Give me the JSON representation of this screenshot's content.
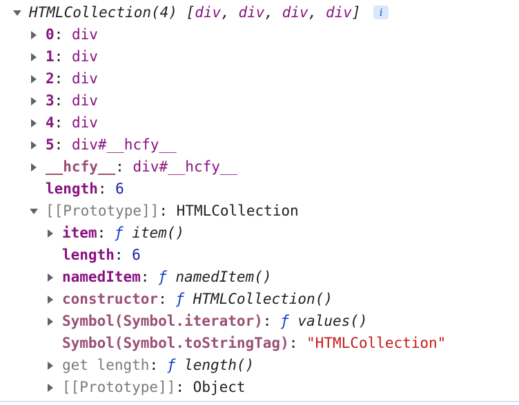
{
  "header": {
    "label": "HTMLCollection(4)",
    "preview_open": "[",
    "preview_items": [
      "div",
      "div",
      "div",
      "div"
    ],
    "preview_sep": ", ",
    "preview_close": "]",
    "info_icon": "i"
  },
  "items": [
    {
      "key": "0",
      "value": "div"
    },
    {
      "key": "1",
      "value": "div"
    },
    {
      "key": "2",
      "value": "div"
    },
    {
      "key": "3",
      "value": "div"
    },
    {
      "key": "4",
      "value": "div"
    },
    {
      "key": "5",
      "value": "div#__hcfy__"
    }
  ],
  "named": {
    "key": "__hcfy__",
    "value": "div#__hcfy__"
  },
  "length": {
    "key": "length",
    "value": "6"
  },
  "prototype": {
    "key": "[[Prototype]]",
    "value": "HTMLCollection"
  },
  "proto_members": {
    "item": {
      "key": "item",
      "f": "ƒ",
      "sig": "item()"
    },
    "length": {
      "key": "length",
      "value": "6"
    },
    "namedItem": {
      "key": "namedItem",
      "f": "ƒ",
      "sig": "namedItem()"
    },
    "constructor": {
      "key": "constructor",
      "f": "ƒ",
      "sig": "HTMLCollection()"
    },
    "iterator": {
      "key": "Symbol(Symbol.iterator)",
      "f": "ƒ",
      "sig": "values()"
    },
    "toStringTag": {
      "key": "Symbol(Symbol.toStringTag)",
      "value": "\"HTMLCollection\""
    },
    "getLength": {
      "key": "get length",
      "f": "ƒ",
      "sig": "length()"
    },
    "proto": {
      "key": "[[Prototype]]",
      "value": "Object"
    }
  },
  "punct": {
    "colon": ": "
  },
  "icons": {
    "expand": "triangle-right-icon",
    "collapse": "triangle-down-icon",
    "info": "info-icon"
  },
  "colors": {
    "own_key": "#881280",
    "inherited_key": "#9a4f75",
    "number": "#1a1aa6",
    "string": "#c41a16",
    "function_keyword": "#0d3cc9",
    "muted": "#7a7a7a",
    "badge_bg": "#dbe7fb"
  }
}
